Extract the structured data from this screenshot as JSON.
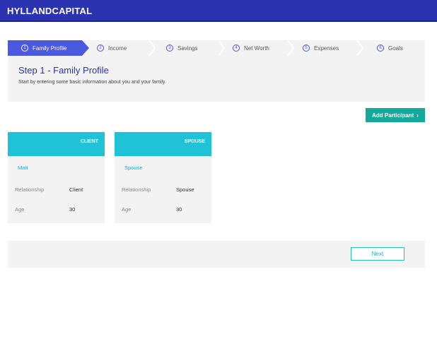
{
  "app": {
    "brand": "HYLLANDCAPITAL"
  },
  "steps": [
    {
      "num": "1",
      "label": "Family Profile",
      "active": true
    },
    {
      "num": "2",
      "label": "Income",
      "active": false
    },
    {
      "num": "3",
      "label": "Savings",
      "active": false
    },
    {
      "num": "4",
      "label": "Net Worth",
      "active": false
    },
    {
      "num": "5",
      "label": "Expenses",
      "active": false
    },
    {
      "num": "6",
      "label": "Goals",
      "active": false
    }
  ],
  "header": {
    "title": "Step 1 - Family Profile",
    "subtitle": "Start by entering some basic information about you and your family."
  },
  "actions": {
    "add_participant": "Add Participant",
    "add_arrow": "›",
    "next": "Next"
  },
  "participants": [
    {
      "role": "CLIENT",
      "name": "Matt",
      "relationship_label": "Relationship",
      "relationship": "Client",
      "age_label": "Age",
      "age": "30"
    },
    {
      "role": "SPOUSE",
      "name": "Spouse",
      "relationship_label": "Relationship",
      "relationship": "Spouse",
      "age_label": "Age",
      "age": "30"
    }
  ],
  "colors": {
    "brand": "#2b33b0",
    "active_step": "#4b58e0",
    "accent_teal": "#1fc2d6",
    "button_green": "#12a89a"
  }
}
